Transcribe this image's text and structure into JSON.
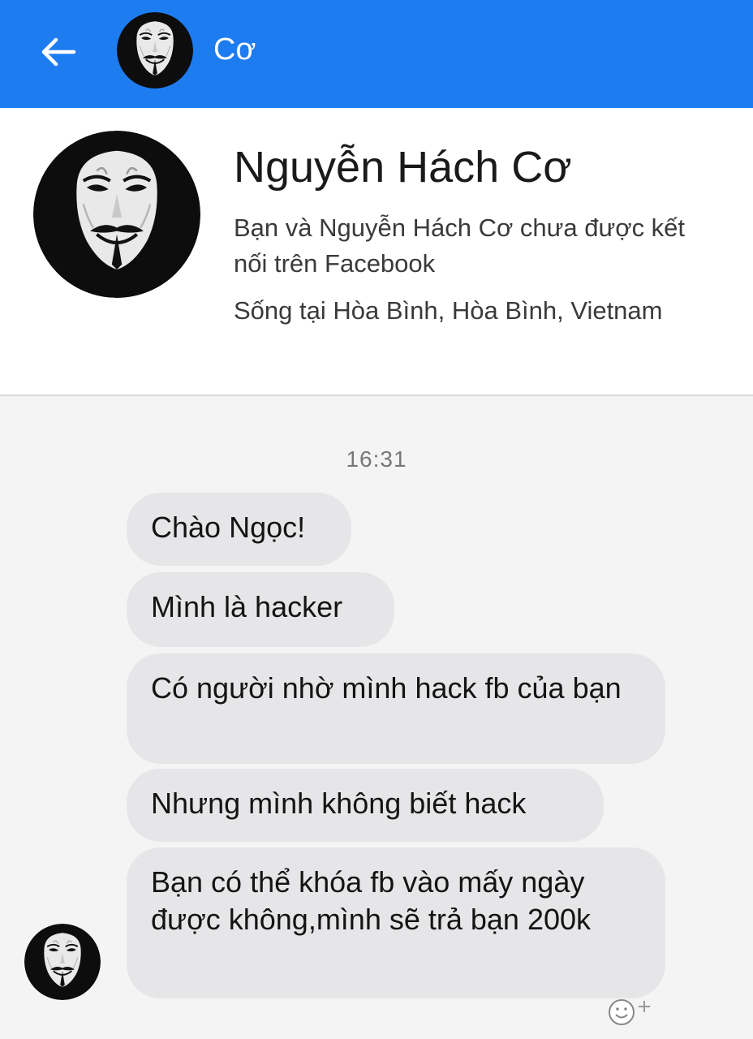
{
  "header": {
    "title": "Cơ",
    "back_icon": "arrow-left-icon",
    "background": "#1e7cf1"
  },
  "profile": {
    "name": "Nguyễn Hách Cơ",
    "connection_text": "Bạn và Nguyễn Hách Cơ chưa được kết nối trên Facebook",
    "location_text": "Sống tại Hòa Bình, Hòa Bình, Vietnam",
    "avatar_icon": "guy-fawkes-mask-avatar"
  },
  "chat": {
    "timestamp": "16:31",
    "messages": [
      {
        "text": "Chào Ngọc!"
      },
      {
        "text": "Mình là hacker"
      },
      {
        "text": "Có người nhờ mình hack fb của bạn"
      },
      {
        "text": "Nhưng mình không biết hack"
      },
      {
        "text": "Bạn có thể khóa fb vào mấy ngày được không,mình sẽ trả bạn 200k"
      }
    ],
    "bubble_color": "#e6e6e8",
    "reaction_icon": "add-reaction-icon"
  }
}
